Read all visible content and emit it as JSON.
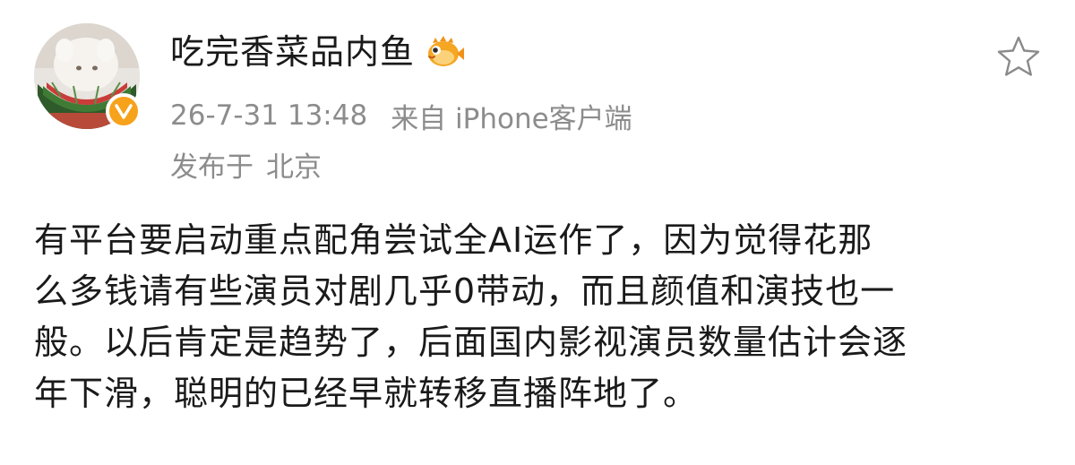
{
  "post": {
    "username": "吃完香菜品内鱼",
    "timestamp": "26-7-31 13:48",
    "source": "来自 iPhone客户端",
    "location_label": "发布于",
    "location": "北京",
    "content_lines": [
      "有平台要启动重点配角尝试全AI运作了，因为觉得花那",
      "么多钱请有些演员对剧几乎0带动，而且颜值和演技也一",
      "般。以后肯定是趋势了，后面国内影视演员数量估计会逐",
      "年下滑，聪明的已经早就转移直播阵地了。"
    ]
  },
  "icons": {
    "verified": "verified-v-icon",
    "fan_badge": "pufferfish-icon",
    "favorite": "star-outline-icon"
  },
  "colors": {
    "text_primary": "#1a1a1a",
    "text_secondary": "#8c8c8c",
    "verified_badge": "#f7a21b",
    "fish_badge": "#f5a623"
  }
}
